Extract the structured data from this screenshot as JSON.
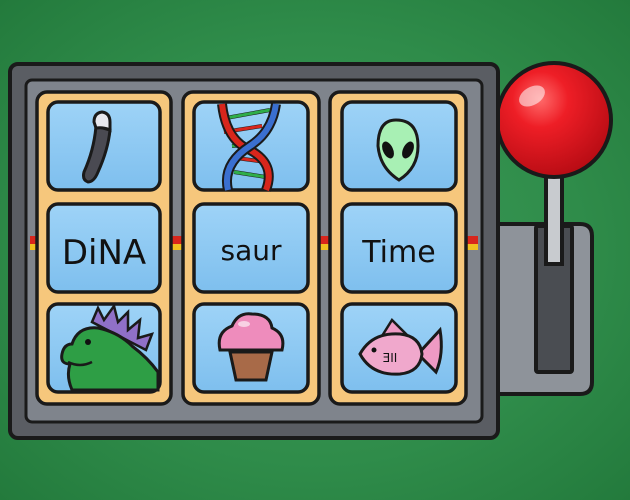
{
  "game": {
    "reels": [
      {
        "top": "worm-icon",
        "middle": "DiNA",
        "bottom": "dinosaur-icon"
      },
      {
        "top": "dna-helix-icon",
        "middle": "saur",
        "bottom": "cupcake-icon"
      },
      {
        "top": "alien-head-icon",
        "middle": "Time",
        "bottom": "fish-icon"
      }
    ],
    "fish_mark": "ƎII"
  },
  "colors": {
    "background": "#2f8c4a",
    "cabinet": "#5a5d63",
    "cabinet_inner": "#7f848c",
    "reel_strip": "#f6c77c",
    "symbol_tile": "#8cc8f2",
    "lever_knob": "#e5141e",
    "payline_red": "#d8261c",
    "payline_yellow": "#f0c020"
  }
}
